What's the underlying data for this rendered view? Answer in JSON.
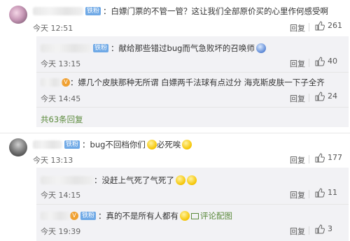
{
  "comments": [
    {
      "badge": "铁粉",
      "text": "：白嫖门票的不管一管？这让我们全部原价买的心里作何感受啊",
      "time": "今天 12:51",
      "reply": "回复",
      "likes": "261",
      "avatar_icon": "user-avatar"
    },
    {
      "badge": "铁粉",
      "text": "：献给那些错过bug而气急败坏的召唤师",
      "time": "今天 13:15",
      "reply": "回复",
      "likes": "40"
    },
    {
      "badge": "vip",
      "text": "：嫖几个皮肤那种无所谓 白嫖两千法球有点过分 海克斯皮肤一下子全齐",
      "time": "今天 14:45",
      "reply": "回复",
      "likes": "24"
    },
    {
      "more": "共63条回复"
    },
    {
      "badge": "铁粉",
      "text": "：bug不回档你们",
      "text_after": "必死唉",
      "time": "今天 13:13",
      "reply": "回复",
      "likes": "177",
      "avatar_icon": "user-avatar"
    },
    {
      "text": "：没赶上气死了气死了",
      "time": "今天 14:15",
      "reply": "回复",
      "likes": "11"
    },
    {
      "badge": "铁粉",
      "text": "：真的不是所有人都有",
      "pic_label": "评论配图",
      "time": "今天 19:39",
      "reply": "回复",
      "likes": "3"
    }
  ],
  "colors": {
    "badge": "#6fa9e6",
    "link_green": "#5b8a3c",
    "subbox_bg": "#f2f2f5"
  }
}
